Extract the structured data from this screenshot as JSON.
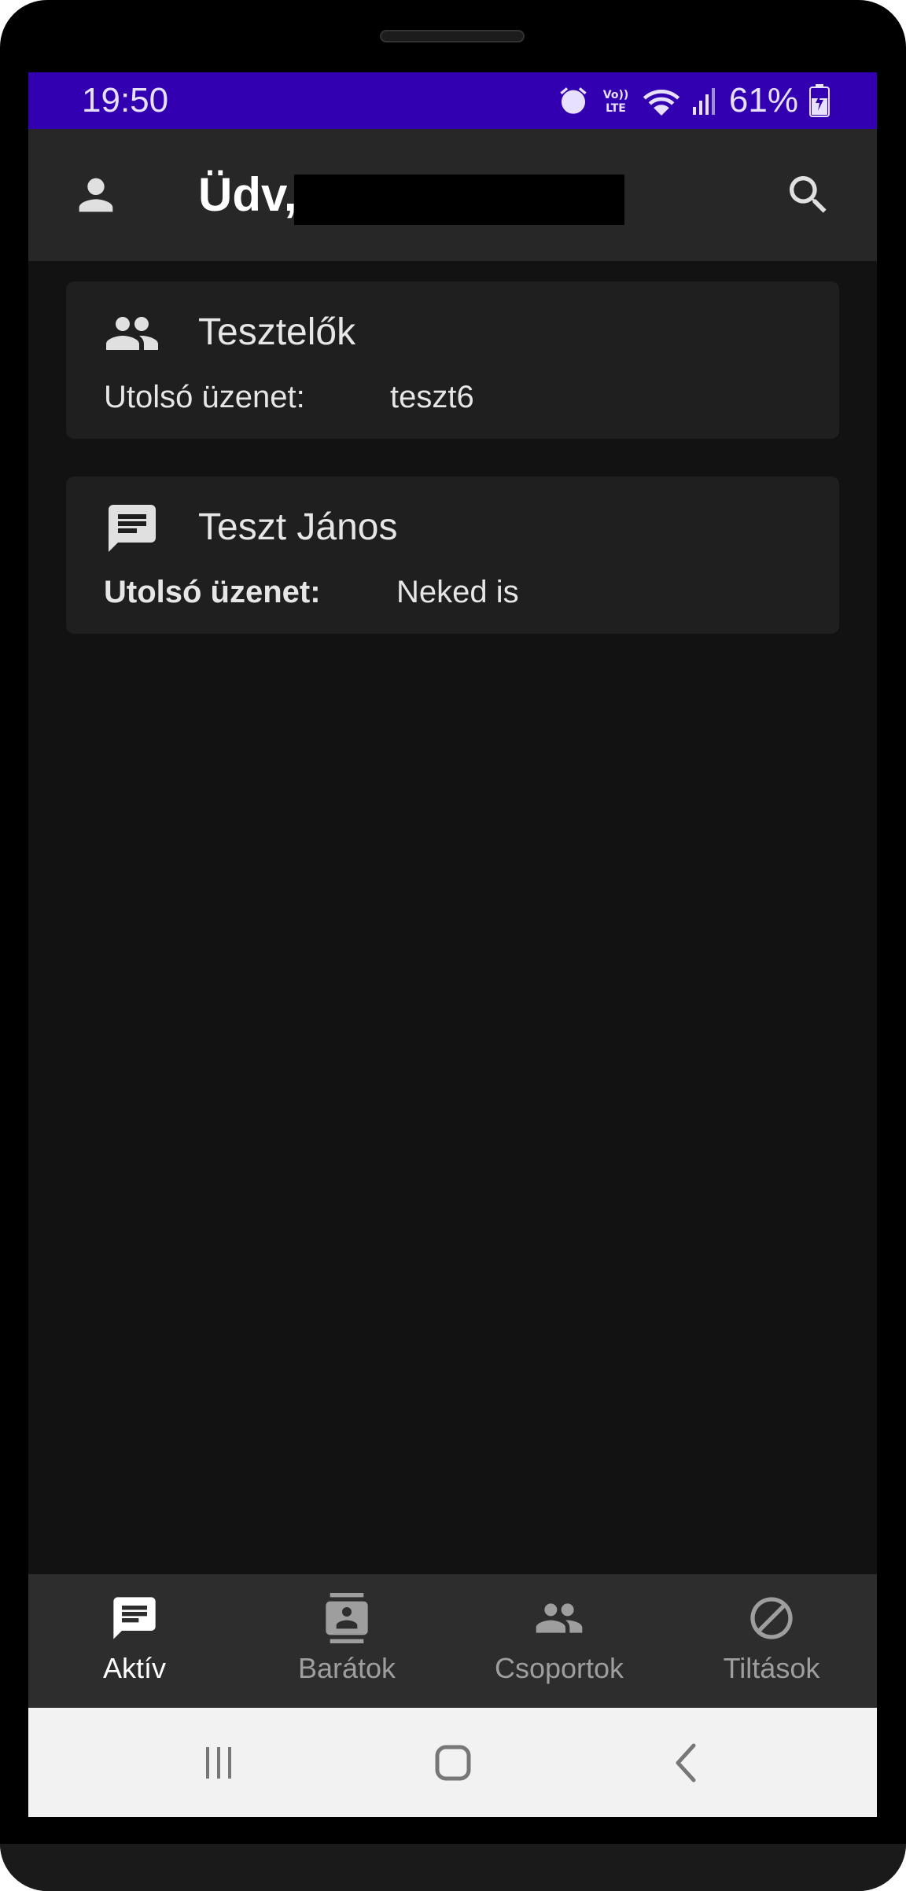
{
  "status_bar": {
    "time": "19:50",
    "volte_label": "Vo)) LTE",
    "battery_percent": "61%",
    "icons": [
      "alarm-icon",
      "volte-icon",
      "wifi-icon",
      "signal-icon",
      "battery-charging-icon"
    ],
    "background_color": "#3200b0"
  },
  "app_bar": {
    "greeting": "Üdv,",
    "user_name_redacted": true,
    "icons": [
      "profile-icon",
      "search-icon"
    ]
  },
  "conversations": [
    {
      "icon": "group-icon",
      "title": "Tesztelők",
      "last_message_label": "Utolsó üzenet:",
      "last_message": "teszt6",
      "unread": false
    },
    {
      "icon": "chat-icon",
      "title": "Teszt János",
      "last_message_label": "Utolsó üzenet:",
      "last_message": "Neked is",
      "unread": true
    }
  ],
  "bottom_nav": {
    "items": [
      {
        "label": "Aktív",
        "icon": "chat-icon",
        "active": true
      },
      {
        "label": "Barátok",
        "icon": "contacts-icon",
        "active": false
      },
      {
        "label": "Csoportok",
        "icon": "group-icon",
        "active": false
      },
      {
        "label": "Tiltások",
        "icon": "block-icon",
        "active": false
      }
    ]
  },
  "system_nav": {
    "buttons": [
      "recent-apps-icon",
      "home-icon",
      "back-icon"
    ]
  },
  "colors": {
    "accent_status_bar": "#3200b0",
    "app_bar": "#272727",
    "background": "#121212",
    "card": "#1f1f1f",
    "bottom_nav": "#2d2d2d"
  }
}
